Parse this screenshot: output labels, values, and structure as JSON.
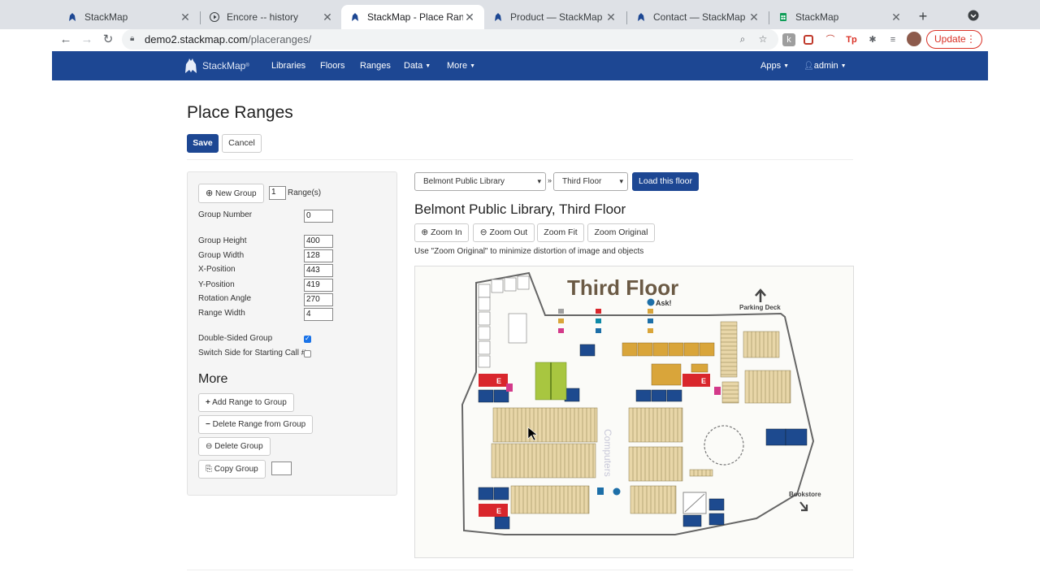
{
  "browser": {
    "tabs": [
      {
        "title": "StackMap",
        "icon": "stackmap-icon"
      },
      {
        "title": "Encore -- history",
        "icon": "play-icon"
      },
      {
        "title": "StackMap - Place Ranges",
        "icon": "stackmap-icon"
      },
      {
        "title": "Product — StackMap",
        "icon": "stackmap-icon"
      },
      {
        "title": "Contact — StackMap",
        "icon": "stackmap-icon"
      },
      {
        "title": "StackMap",
        "icon": "sheets-icon"
      }
    ],
    "url_host": "demo2.stackmap.com",
    "url_path": "/placeranges/",
    "update_label": "Update"
  },
  "nav": {
    "brand": "StackMap",
    "links": [
      "Libraries",
      "Floors",
      "Ranges"
    ],
    "data_label": "Data",
    "more_label": "More",
    "apps_label": "Apps",
    "user_label": "admin"
  },
  "page": {
    "title": "Place Ranges",
    "save_label": "Save",
    "cancel_label": "Cancel"
  },
  "group_form": {
    "new_group_label": "New Group",
    "range_count": "1",
    "range_count_label": "Range(s)",
    "group_number_label": "Group Number",
    "group_number": "0",
    "fields": [
      {
        "label": "Group Height",
        "value": "400"
      },
      {
        "label": "Group Width",
        "value": "128"
      },
      {
        "label": "X-Position",
        "value": "443"
      },
      {
        "label": "Y-Position",
        "value": "419"
      },
      {
        "label": "Rotation Angle",
        "value": "270"
      },
      {
        "label": "Range Width",
        "value": "4"
      }
    ],
    "double_sided_label": "Double-Sided Group",
    "double_sided": true,
    "switch_side_label": "Switch Side for Starting Call #",
    "switch_side": false,
    "more_heading": "More",
    "add_range_label": "Add Range to Group",
    "delete_range_label": "Delete Range from Group",
    "delete_group_label": "Delete Group",
    "copy_group_label": "Copy Group"
  },
  "floor_select": {
    "library": "Belmont Public Library",
    "floor": "Third Floor",
    "load_label": "Load this floor",
    "heading": "Belmont Public Library, Third Floor",
    "zoom_in": "Zoom In",
    "zoom_out": "Zoom Out",
    "zoom_fit": "Zoom Fit",
    "zoom_original": "Zoom Original",
    "hint": "Use \"Zoom Original\" to minimize distortion of image and objects"
  },
  "map": {
    "title": "Third Floor",
    "parking": "Parking Deck",
    "bookstore": "Bookstore",
    "computers": "Computers",
    "ask": "Ask!",
    "colors": {
      "accent": "#1d4793",
      "exit": "#d9262c",
      "gold": "#d9a53a",
      "green": "#a8c640"
    }
  }
}
